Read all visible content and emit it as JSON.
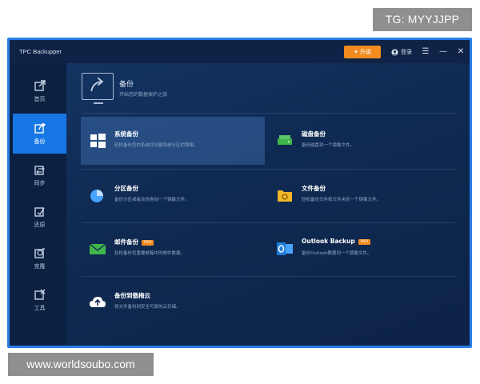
{
  "overlay": {
    "tg_label": "TG: MYYJJPP",
    "website_label": "www.worldsoubo.com"
  },
  "window": {
    "title": "TPC Backupper",
    "upgrade_label": "升级",
    "login_label": "登录"
  },
  "sidebar": {
    "items": [
      {
        "label": "首页",
        "icon": "home-icon"
      },
      {
        "label": "备份",
        "icon": "backup-icon",
        "active": true
      },
      {
        "label": "同步",
        "icon": "sync-icon"
      },
      {
        "label": "还原",
        "icon": "restore-icon"
      },
      {
        "label": "克隆",
        "icon": "clone-icon"
      },
      {
        "label": "工具",
        "icon": "tools-icon"
      }
    ]
  },
  "header": {
    "title": "备份",
    "subtitle": "开始您的数据保护之旅"
  },
  "tiles": [
    {
      "title": "系统备份",
      "desc": "轻松备份您的系统并创建系统分区的镜像。",
      "icon": "windows-icon"
    },
    {
      "title": "磁盘备份",
      "desc": "备份磁盘到一个镜像文件。",
      "icon": "disk-icon"
    },
    {
      "title": "分区备份",
      "desc": "备份分区或者动态卷到一个镜像文件。",
      "icon": "partition-icon"
    },
    {
      "title": "文件备份",
      "desc": "轻松备份文件和文件夹到一个镜像文件。",
      "icon": "folder-icon"
    },
    {
      "title": "邮件备份",
      "badge": "PRO",
      "desc": "轻松备份您重要邮箱中的邮件数据。",
      "icon": "mail-icon"
    },
    {
      "title": "Outlook Backup",
      "badge": "PRO",
      "desc": "备份Outlook数据到一个镜像文件。",
      "icon": "outlook-icon"
    },
    {
      "title": "备份到傲梅云",
      "desc": "将文件备份到安全可靠的云存储。",
      "icon": "cloud-upload-icon"
    }
  ],
  "colors": {
    "accent": "#1677e5",
    "upgrade": "#f18b1f",
    "border": "#2a7de6",
    "background": "#143666"
  }
}
